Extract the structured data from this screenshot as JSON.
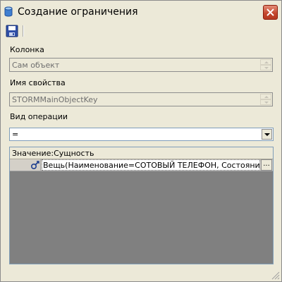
{
  "window": {
    "title": "Создание ограничения",
    "close_icon": "close-icon",
    "app_icon": "database-icon"
  },
  "toolbar": {
    "save_icon": "save-icon"
  },
  "form": {
    "column_label": "Колонка",
    "column_value": "Сам объект",
    "property_label": "Имя свойства",
    "property_value": "STORMMainObjectKey",
    "operation_label": "Вид операции",
    "operation_value": "="
  },
  "grid": {
    "header": "Значение:Сущность",
    "rows": [
      {
        "icon": "link-object-icon",
        "value": "Вещь(Наименование=СОТОВЫЙ ТЕЛЕФОН, Состояние=Пе",
        "button_label": "..."
      }
    ]
  },
  "colors": {
    "window_bg": "#ece9d8",
    "grid_bg": "#808080",
    "close_button": "#c3452c",
    "readonly_text": "#6f6f6f"
  }
}
